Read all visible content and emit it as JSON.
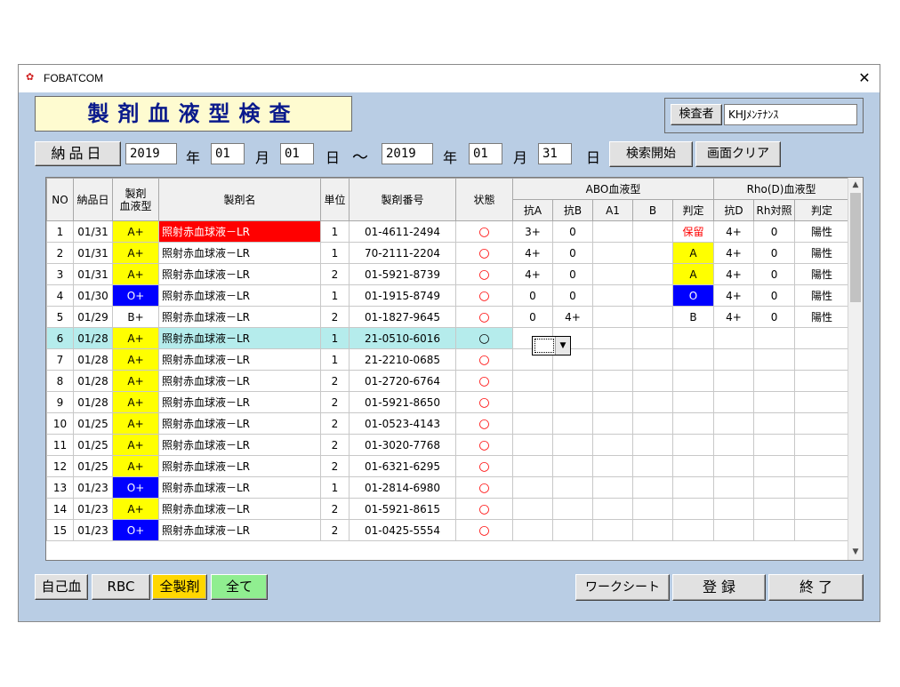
{
  "window": {
    "title": "FOBATCOM",
    "close_label": "✕"
  },
  "heading": "製剤血液型検査",
  "inspector": {
    "label": "検査者",
    "value": "KHJﾒﾝﾃﾅﾝｽ"
  },
  "date_filter": {
    "button_label": "納品日",
    "from_year": "2019",
    "from_month": "01",
    "from_day": "01",
    "to_year": "2019",
    "to_month": "01",
    "to_day": "31",
    "year_unit": "年",
    "month_unit": "月",
    "day_unit": "日",
    "tilde": "～",
    "search_label": "検索開始",
    "clear_label": "画面クリア"
  },
  "left_table": {
    "headers": [
      "NO",
      "納品日",
      "製剤\n血液型",
      "製剤名",
      "単位",
      "製剤番号",
      "状態"
    ],
    "rows": [
      {
        "no": "1",
        "date": "01/31",
        "type": "A+",
        "name": "照射赤血球液－LR",
        "unit": "1",
        "number": "01-4611-2494",
        "status": "○"
      },
      {
        "no": "2",
        "date": "01/31",
        "type": "A+",
        "name": "照射赤血球液－LR",
        "unit": "1",
        "number": "70-2111-2204",
        "status": "○"
      },
      {
        "no": "3",
        "date": "01/31",
        "type": "A+",
        "name": "照射赤血球液－LR",
        "unit": "2",
        "number": "01-5921-8739",
        "status": "○"
      },
      {
        "no": "4",
        "date": "01/30",
        "type": "O+",
        "name": "照射赤血球液－LR",
        "unit": "1",
        "number": "01-1915-8749",
        "status": "○"
      },
      {
        "no": "5",
        "date": "01/29",
        "type": "B+",
        "name": "照射赤血球液－LR",
        "unit": "2",
        "number": "01-1827-9645",
        "status": "○"
      },
      {
        "no": "6",
        "date": "01/28",
        "type": "A+",
        "name": "照射赤血球液－LR",
        "unit": "1",
        "number": "21-0510-6016",
        "status": "○"
      },
      {
        "no": "7",
        "date": "01/28",
        "type": "A+",
        "name": "照射赤血球液－LR",
        "unit": "1",
        "number": "21-2210-0685",
        "status": "○"
      },
      {
        "no": "8",
        "date": "01/28",
        "type": "A+",
        "name": "照射赤血球液－LR",
        "unit": "2",
        "number": "01-2720-6764",
        "status": "○"
      },
      {
        "no": "9",
        "date": "01/28",
        "type": "A+",
        "name": "照射赤血球液－LR",
        "unit": "2",
        "number": "01-5921-8650",
        "status": "○"
      },
      {
        "no": "10",
        "date": "01/25",
        "type": "A+",
        "name": "照射赤血球液－LR",
        "unit": "2",
        "number": "01-0523-4143",
        "status": "○"
      },
      {
        "no": "11",
        "date": "01/25",
        "type": "A+",
        "name": "照射赤血球液－LR",
        "unit": "2",
        "number": "01-3020-7768",
        "status": "○"
      },
      {
        "no": "12",
        "date": "01/25",
        "type": "A+",
        "name": "照射赤血球液－LR",
        "unit": "2",
        "number": "01-6321-6295",
        "status": "○"
      },
      {
        "no": "13",
        "date": "01/23",
        "type": "O+",
        "name": "照射赤血球液－LR",
        "unit": "1",
        "number": "01-2814-6980",
        "status": "○"
      },
      {
        "no": "14",
        "date": "01/23",
        "type": "A+",
        "name": "照射赤血球液－LR",
        "unit": "2",
        "number": "01-5921-8615",
        "status": "○"
      },
      {
        "no": "15",
        "date": "01/23",
        "type": "O+",
        "name": "照射赤血球液－LR",
        "unit": "2",
        "number": "01-0425-5554",
        "status": "○"
      }
    ]
  },
  "right_table": {
    "group_headers": [
      "ABO血液型",
      "Rho(D)血液型"
    ],
    "headers": [
      "抗A",
      "抗B",
      "A1",
      "B",
      "判定",
      "抗D",
      "Rh対照",
      "判定"
    ],
    "rows": [
      {
        "antiA": "3+",
        "antiB": "0",
        "a1": "",
        "b": "",
        "abo": "保留",
        "antiD": "4+",
        "rhctl": "0",
        "rh": "陽性"
      },
      {
        "antiA": "4+",
        "antiB": "0",
        "a1": "",
        "b": "",
        "abo": "A",
        "antiD": "4+",
        "rhctl": "0",
        "rh": "陽性"
      },
      {
        "antiA": "4+",
        "antiB": "0",
        "a1": "",
        "b": "",
        "abo": "A",
        "antiD": "4+",
        "rhctl": "0",
        "rh": "陽性"
      },
      {
        "antiA": "0",
        "antiB": "0",
        "a1": "",
        "b": "",
        "abo": "O",
        "antiD": "4+",
        "rhctl": "0",
        "rh": "陽性"
      },
      {
        "antiA": "0",
        "antiB": "4+",
        "a1": "",
        "b": "",
        "abo": "B",
        "antiD": "4+",
        "rhctl": "0",
        "rh": "陽性"
      }
    ],
    "empty_rows": 10
  },
  "bottom_buttons": {
    "self_blood": "自己血",
    "rbc": "RBC",
    "all_products": "全製剤",
    "all": "全て",
    "worksheet": "ワークシート",
    "register": "登 録",
    "exit": "終 了"
  },
  "colors": {
    "yellow": "#ffff00",
    "blue": "#0000ff",
    "red": "#ff0000",
    "selected_row": "#b5ecec",
    "window_bg": "#b9cde4",
    "heading_bg": "#fefbd0"
  }
}
